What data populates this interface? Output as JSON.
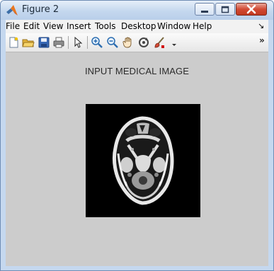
{
  "window": {
    "title": "Figure 2"
  },
  "menu": [
    "File",
    "Edit",
    "View",
    "Insert",
    "Tools",
    "Desktop",
    "Window",
    "Help"
  ],
  "menubar_chevron": "↘",
  "toolbar": {
    "icons": [
      "new-file-icon",
      "open-folder-icon",
      "save-icon",
      "print-icon",
      "pointer-icon",
      "zoom-in-icon",
      "zoom-out-icon",
      "pan-hand-icon",
      "rotate-3d-icon",
      "data-brush-icon"
    ],
    "overflow_label": "»"
  },
  "figure": {
    "axes_title": "INPUT MEDICAL IMAGE"
  },
  "colors": {
    "title_bar": "#c4d7ee",
    "figure_bg": "#cccccc",
    "close_button": "#c13820",
    "window_frame": "#c5d8ef"
  }
}
